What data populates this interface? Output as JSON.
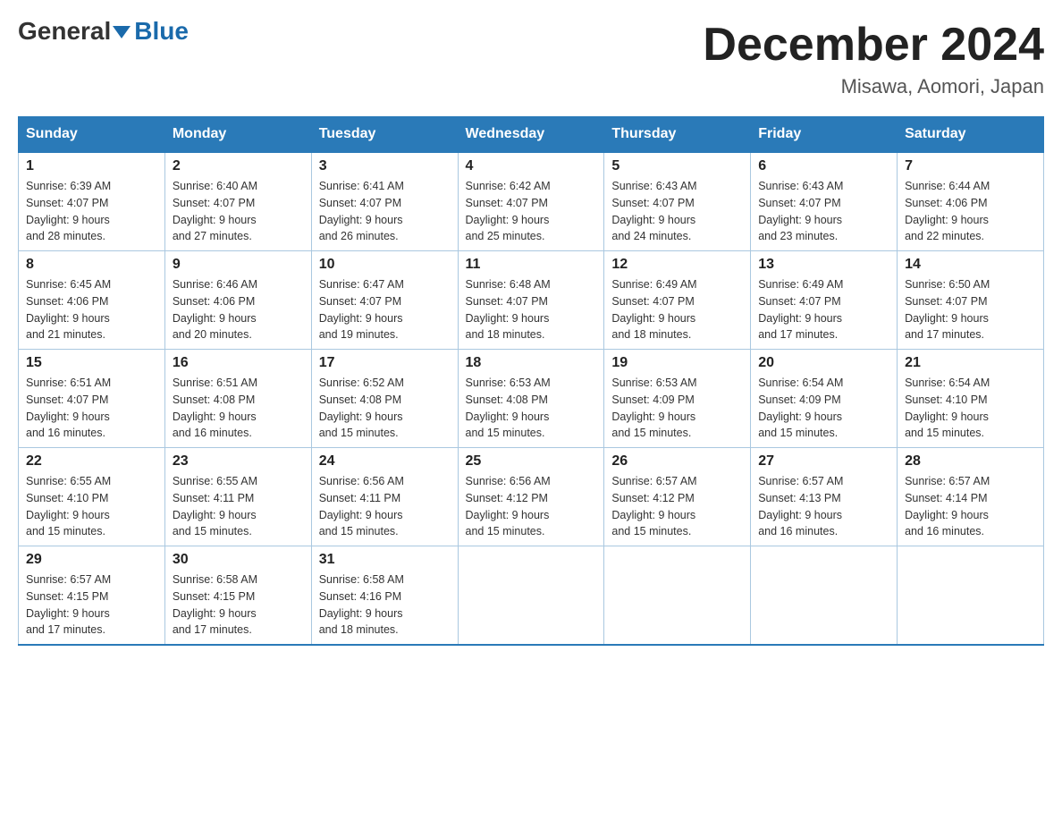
{
  "header": {
    "logo_general": "General",
    "logo_blue": "Blue",
    "month_title": "December 2024",
    "location": "Misawa, Aomori, Japan"
  },
  "weekdays": [
    "Sunday",
    "Monday",
    "Tuesday",
    "Wednesday",
    "Thursday",
    "Friday",
    "Saturday"
  ],
  "weeks": [
    [
      {
        "day": "1",
        "sunrise": "6:39 AM",
        "sunset": "4:07 PM",
        "daylight": "9 hours and 28 minutes."
      },
      {
        "day": "2",
        "sunrise": "6:40 AM",
        "sunset": "4:07 PM",
        "daylight": "9 hours and 27 minutes."
      },
      {
        "day": "3",
        "sunrise": "6:41 AM",
        "sunset": "4:07 PM",
        "daylight": "9 hours and 26 minutes."
      },
      {
        "day": "4",
        "sunrise": "6:42 AM",
        "sunset": "4:07 PM",
        "daylight": "9 hours and 25 minutes."
      },
      {
        "day": "5",
        "sunrise": "6:43 AM",
        "sunset": "4:07 PM",
        "daylight": "9 hours and 24 minutes."
      },
      {
        "day": "6",
        "sunrise": "6:43 AM",
        "sunset": "4:07 PM",
        "daylight": "9 hours and 23 minutes."
      },
      {
        "day": "7",
        "sunrise": "6:44 AM",
        "sunset": "4:06 PM",
        "daylight": "9 hours and 22 minutes."
      }
    ],
    [
      {
        "day": "8",
        "sunrise": "6:45 AM",
        "sunset": "4:06 PM",
        "daylight": "9 hours and 21 minutes."
      },
      {
        "day": "9",
        "sunrise": "6:46 AM",
        "sunset": "4:06 PM",
        "daylight": "9 hours and 20 minutes."
      },
      {
        "day": "10",
        "sunrise": "6:47 AM",
        "sunset": "4:07 PM",
        "daylight": "9 hours and 19 minutes."
      },
      {
        "day": "11",
        "sunrise": "6:48 AM",
        "sunset": "4:07 PM",
        "daylight": "9 hours and 18 minutes."
      },
      {
        "day": "12",
        "sunrise": "6:49 AM",
        "sunset": "4:07 PM",
        "daylight": "9 hours and 18 minutes."
      },
      {
        "day": "13",
        "sunrise": "6:49 AM",
        "sunset": "4:07 PM",
        "daylight": "9 hours and 17 minutes."
      },
      {
        "day": "14",
        "sunrise": "6:50 AM",
        "sunset": "4:07 PM",
        "daylight": "9 hours and 17 minutes."
      }
    ],
    [
      {
        "day": "15",
        "sunrise": "6:51 AM",
        "sunset": "4:07 PM",
        "daylight": "9 hours and 16 minutes."
      },
      {
        "day": "16",
        "sunrise": "6:51 AM",
        "sunset": "4:08 PM",
        "daylight": "9 hours and 16 minutes."
      },
      {
        "day": "17",
        "sunrise": "6:52 AM",
        "sunset": "4:08 PM",
        "daylight": "9 hours and 15 minutes."
      },
      {
        "day": "18",
        "sunrise": "6:53 AM",
        "sunset": "4:08 PM",
        "daylight": "9 hours and 15 minutes."
      },
      {
        "day": "19",
        "sunrise": "6:53 AM",
        "sunset": "4:09 PM",
        "daylight": "9 hours and 15 minutes."
      },
      {
        "day": "20",
        "sunrise": "6:54 AM",
        "sunset": "4:09 PM",
        "daylight": "9 hours and 15 minutes."
      },
      {
        "day": "21",
        "sunrise": "6:54 AM",
        "sunset": "4:10 PM",
        "daylight": "9 hours and 15 minutes."
      }
    ],
    [
      {
        "day": "22",
        "sunrise": "6:55 AM",
        "sunset": "4:10 PM",
        "daylight": "9 hours and 15 minutes."
      },
      {
        "day": "23",
        "sunrise": "6:55 AM",
        "sunset": "4:11 PM",
        "daylight": "9 hours and 15 minutes."
      },
      {
        "day": "24",
        "sunrise": "6:56 AM",
        "sunset": "4:11 PM",
        "daylight": "9 hours and 15 minutes."
      },
      {
        "day": "25",
        "sunrise": "6:56 AM",
        "sunset": "4:12 PM",
        "daylight": "9 hours and 15 minutes."
      },
      {
        "day": "26",
        "sunrise": "6:57 AM",
        "sunset": "4:12 PM",
        "daylight": "9 hours and 15 minutes."
      },
      {
        "day": "27",
        "sunrise": "6:57 AM",
        "sunset": "4:13 PM",
        "daylight": "9 hours and 16 minutes."
      },
      {
        "day": "28",
        "sunrise": "6:57 AM",
        "sunset": "4:14 PM",
        "daylight": "9 hours and 16 minutes."
      }
    ],
    [
      {
        "day": "29",
        "sunrise": "6:57 AM",
        "sunset": "4:15 PM",
        "daylight": "9 hours and 17 minutes."
      },
      {
        "day": "30",
        "sunrise": "6:58 AM",
        "sunset": "4:15 PM",
        "daylight": "9 hours and 17 minutes."
      },
      {
        "day": "31",
        "sunrise": "6:58 AM",
        "sunset": "4:16 PM",
        "daylight": "9 hours and 18 minutes."
      },
      null,
      null,
      null,
      null
    ]
  ],
  "labels": {
    "sunrise": "Sunrise:",
    "sunset": "Sunset:",
    "daylight": "Daylight:"
  }
}
